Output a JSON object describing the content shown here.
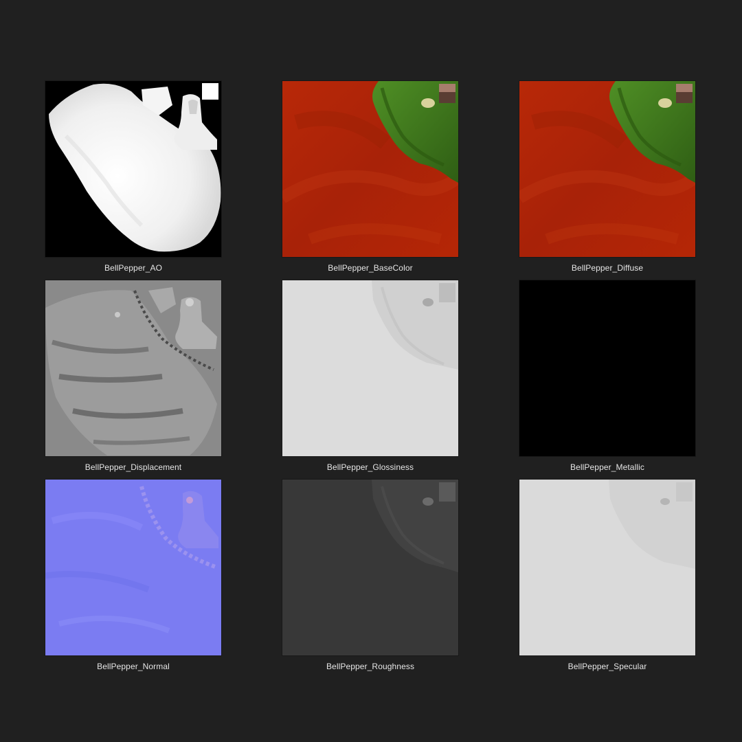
{
  "textures": [
    {
      "id": "ao",
      "label": "BellPepper_AO"
    },
    {
      "id": "basecolor",
      "label": "BellPepper_BaseColor"
    },
    {
      "id": "diffuse",
      "label": "BellPepper_Diffuse"
    },
    {
      "id": "displacement",
      "label": "BellPepper_Displacement"
    },
    {
      "id": "glossiness",
      "label": "BellPepper_Glossiness"
    },
    {
      "id": "metallic",
      "label": "BellPepper_Metallic"
    },
    {
      "id": "normal",
      "label": "BellPepper_Normal"
    },
    {
      "id": "roughness",
      "label": "BellPepper_Roughness"
    },
    {
      "id": "specular",
      "label": "BellPepper_Specular"
    }
  ],
  "colors": {
    "background": "#202020",
    "label": "#e6e6e6",
    "pepper_red": "#b42408",
    "stem_green": "#3f7a1c",
    "normal_blue": "#7b7cf2"
  }
}
